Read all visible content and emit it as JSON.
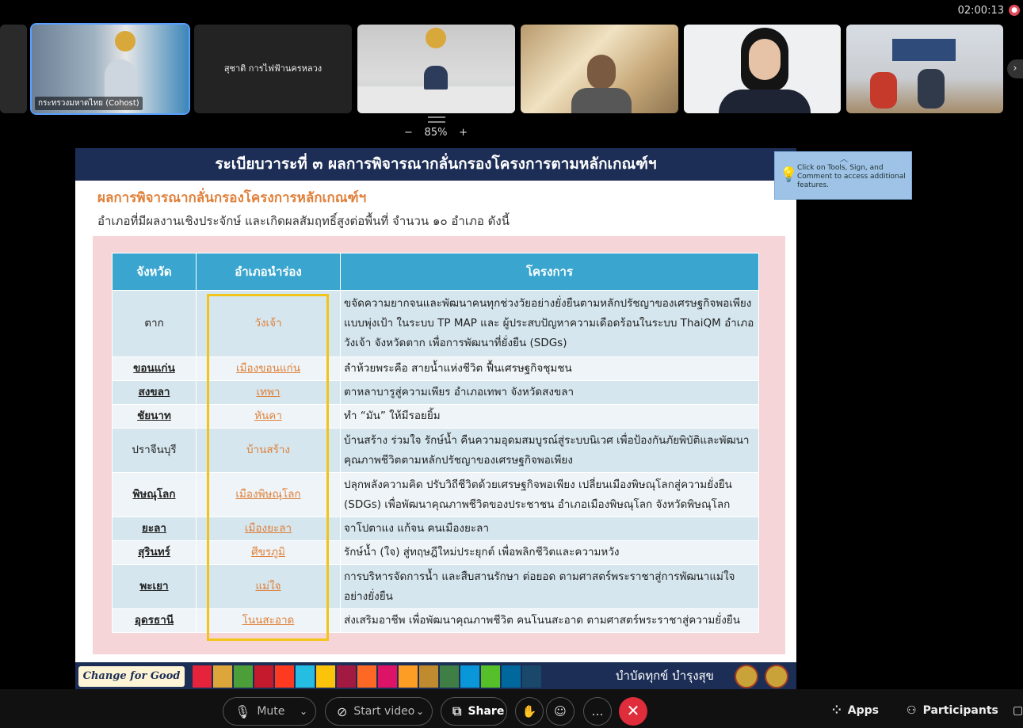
{
  "meeting": {
    "timer": "02:00:13",
    "zoom_level": "85%",
    "zoom_minus": "−",
    "zoom_plus": "+"
  },
  "participants": [
    {
      "name": "กระทรวงมหาดไทย (Cohost)",
      "has_video": true,
      "active": true
    },
    {
      "name": "สุชาติ การไฟฟ้านครหลวง",
      "has_video": false,
      "active": false
    },
    {
      "name": "",
      "has_video": true,
      "active": false
    },
    {
      "name": "",
      "has_video": true,
      "active": false
    },
    {
      "name": "",
      "has_video": true,
      "active": false
    },
    {
      "name": "",
      "has_video": true,
      "active": false
    }
  ],
  "slide": {
    "header": "ระเบียบวาระที่ ๓ ผลการพิจารณากลั่นกรองโครงการตามหลักเกณฑ์ฯ",
    "subtitle1": "ผลการพิจารณากลั่นกรองโครงการหลักเกณฑ์ฯ",
    "subtitle2": "อำเภอที่มีผลงานเชิงประจักษ์ และเกิดผลสัมฤทธิ์สูงต่อพื้นที่ จำนวน ๑๐ อำเภอ ดังนี้",
    "columns": [
      "จังหวัด",
      "อำเภอนำร่อง",
      "โครงการ"
    ],
    "rows": [
      {
        "province": "ตาก",
        "district": "วังเจ้า",
        "project": "ขจัดความยากจนและพัฒนาคนทุกช่วงวัยอย่างยั่งยืนตามหลักปรัชญาของเศรษฐกิจพอเพียงแบบพุ่งเป้า ในระบบ TP MAP และ ผู้ประสบปัญหาความเดือดร้อนในระบบ ThaiQM อำเภอวังเจ้า จังหวัดตาก เพื่อการพัฒนาที่ยั่งยืน (SDGs)",
        "linked": false
      },
      {
        "province": "ขอนแก่น",
        "district": "เมืองขอนแก่น",
        "project": "ลำห้วยพระคือ สายน้ำแห่งชีวิต ฟื้นเศรษฐกิจชุมชน",
        "linked": true
      },
      {
        "province": "สงขลา",
        "district": "เทพา",
        "project": "ตาหลาบารูสู่ความเพียร อำเภอเทพา จังหวัดสงขลา",
        "linked": true
      },
      {
        "province": "ชัยนาท",
        "district": "หันคา",
        "project": "ทำ “มัน” ให้มีรอยยิ้ม",
        "linked": true
      },
      {
        "province": "ปราจีนบุรี",
        "district": "บ้านสร้าง",
        "project": "บ้านสร้าง ร่วมใจ รักษ์น้ำ คืนความอุดมสมบูรณ์สู่ระบบนิเวศ เพื่อป้องกันภัยพิบัติและพัฒนาคุณภาพชีวิตตามหลักปรัชญาของเศรษฐกิจพอเพียง",
        "linked": false
      },
      {
        "province": "พิษณุโลก",
        "district": "เมืองพิษณุโลก",
        "project": "ปลุกพลังความคิด ปรับวิถีชีวิตด้วยเศรษฐกิจพอเพียง เปลี่ยนเมืองพิษณุโลกสู่ความยั่งยืน (SDGs) เพื่อพัฒนาคุณภาพชีวิตของประชาชน อำเภอเมืองพิษณุโลก จังหวัดพิษณุโลก",
        "linked": true
      },
      {
        "province": "ยะลา",
        "district": "เมืองยะลา",
        "project": "จาโปตาแง แก้จน คนเมืองยะลา",
        "linked": true
      },
      {
        "province": "สุรินทร์",
        "district": "ศีขรภูมิ",
        "project": "รักษ์น้ำ (ใจ) สู่ทฤษฎีใหม่ประยุกต์ เพื่อพลิกชีวิตและความหวัง",
        "linked": true
      },
      {
        "province": "พะเยา",
        "district": "แม่ใจ",
        "project": "การบริหารจัดการน้ำ และสืบสานรักษา ต่อยอด ตามศาสตร์พระราชาสู่การพัฒนาแม่ใจอย่างยั่งยืน",
        "linked": true
      },
      {
        "province": "อุดรธานี",
        "district": "โนนสะอาด",
        "project": "ส่งเสริมอาชีพ เพื่อพัฒนาคุณภาพชีวิต คนโนนสะอาด ตามศาสตร์พระราชาสู่ความยั่งยืน",
        "linked": true
      }
    ],
    "footer_logo": "Change for Good",
    "footer_text": "บำบัดทุกข์ บำรุงสุข",
    "sdg_colors": [
      "#e5243b",
      "#dda63a",
      "#4c9f38",
      "#c5192d",
      "#ff3a21",
      "#26bde2",
      "#fcc30b",
      "#a21942",
      "#fd6925",
      "#dd1367",
      "#fd9d24",
      "#bf8b2e",
      "#3f7e44",
      "#0a97d9",
      "#56c02b",
      "#00689d",
      "#19486a"
    ]
  },
  "tooltip": {
    "text": "Click on Tools, Sign, and Comment to access additional features.",
    "icon": "lightbulb-icon"
  },
  "toolbar": {
    "mute": "Mute",
    "start_video": "Start video",
    "share": "Share",
    "apps": "Apps",
    "participants": "Participants"
  }
}
